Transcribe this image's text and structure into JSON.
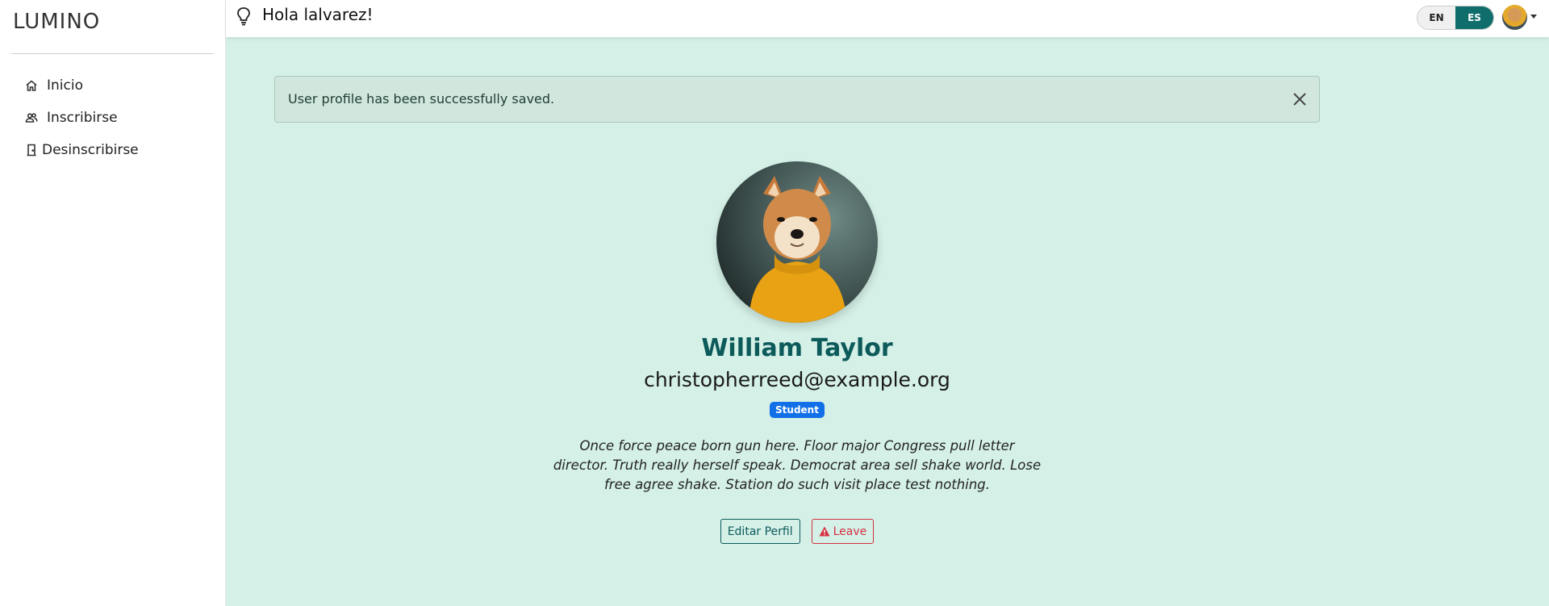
{
  "sidebar": {
    "brand": "LUMINO",
    "items": [
      {
        "label": "Inicio",
        "icon": "home-icon"
      },
      {
        "label": "Inscribirse",
        "icon": "users-icon"
      },
      {
        "label": "Desinscribirse",
        "icon": "door-icon"
      }
    ]
  },
  "topbar": {
    "greeting": "Hola lalvarez!",
    "lang": {
      "en": "EN",
      "es": "ES",
      "active": "ES"
    }
  },
  "alert": {
    "message": "User profile has been successfully saved."
  },
  "profile": {
    "name": "William Taylor",
    "email": "christopherreed@example.org",
    "role": "Student",
    "bio": "Once force peace born gun here. Floor major Congress pull letter director. Truth really herself speak. Democrat area sell shake world. Lose free agree shake. Station do such visit place test nothing."
  },
  "actions": {
    "edit_label": "Editar Perfil",
    "leave_label": "Leave"
  },
  "colors": {
    "main_bg": "#d4f0e7",
    "accent": "#0d5a5b",
    "badge": "#1170e8",
    "danger": "#d63040"
  }
}
